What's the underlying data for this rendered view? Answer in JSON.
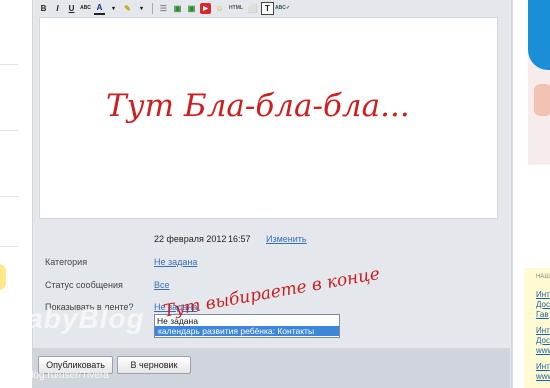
{
  "toolbar": {
    "buttons": [
      "B",
      "I",
      "U",
      "ABC",
      "A",
      "✎",
      "☰",
      "▣",
      "▣",
      "▶",
      "☺",
      "HTML",
      "⬜",
      "T",
      "ABC✓"
    ]
  },
  "editor": {
    "text": "Тут Бла-бла-бла..."
  },
  "meta": {
    "date": "22 февраля 2012",
    "time": "16:57",
    "change_link": "Изменить"
  },
  "fields": {
    "category_label": "Категория",
    "category_value": "Не задана",
    "status_label": "Статус сообщения",
    "status_value": "Все",
    "feed_label": "Показывать в ленте?",
    "feed_value": "Не задана"
  },
  "dropdown": {
    "options": [
      "Не задана",
      "календарь развития ребёнка: Контакты"
    ],
    "selected_index": 1
  },
  "annotation": "Тут выбираете в конце",
  "buttons": {
    "publish": "Опубликовать",
    "draft": "В черновик"
  },
  "watermark": {
    "logo": "BabyBlog",
    "url": "babyblog.ru/user/Tivera"
  },
  "sidebar": {
    "heading": "НАШ",
    "links": [
      "Инт",
      "Дос",
      "Гав",
      "Инт",
      "Дос",
      "www",
      "Инт",
      "www"
    ]
  }
}
